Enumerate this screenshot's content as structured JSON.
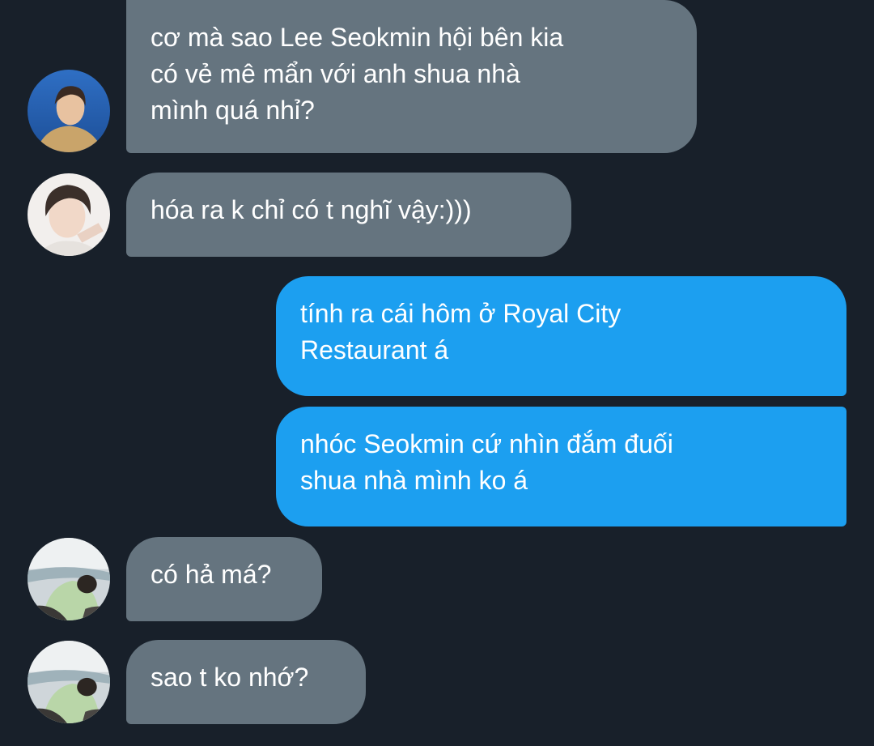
{
  "conversation": {
    "messages": [
      {
        "direction": "incoming",
        "lines": [
          "cơ mà sao Lee Seokmin hội bên kia",
          "có vẻ mê mẩn với anh shua nhà",
          "mình quá nhỉ?"
        ]
      },
      {
        "direction": "incoming",
        "lines": [
          "hóa ra k chỉ có t nghĩ vậy:)))"
        ]
      },
      {
        "direction": "outgoing",
        "lines": [
          "tính ra cái hôm ở Royal City",
          "Restaurant á"
        ]
      },
      {
        "direction": "outgoing",
        "lines": [
          "nhóc Seokmin cứ nhìn đắm đuối",
          "shua nhà mình ko á"
        ]
      },
      {
        "direction": "incoming",
        "lines": [
          "có hả má?"
        ]
      },
      {
        "direction": "incoming",
        "lines": [
          "sao t ko nhớ?"
        ]
      }
    ]
  },
  "colors": {
    "background": "#18202a",
    "incoming_bubble": "#65747f",
    "outgoing_bubble": "#1c9ff0",
    "text": "#ffffff"
  },
  "icons": {
    "avatar_1": "sender-photo-avatar-icon",
    "avatar_2": "sender-photo-avatar-icon",
    "avatar_3": "sender-photo-avatar-icon",
    "avatar_4": "sender-photo-avatar-icon"
  }
}
